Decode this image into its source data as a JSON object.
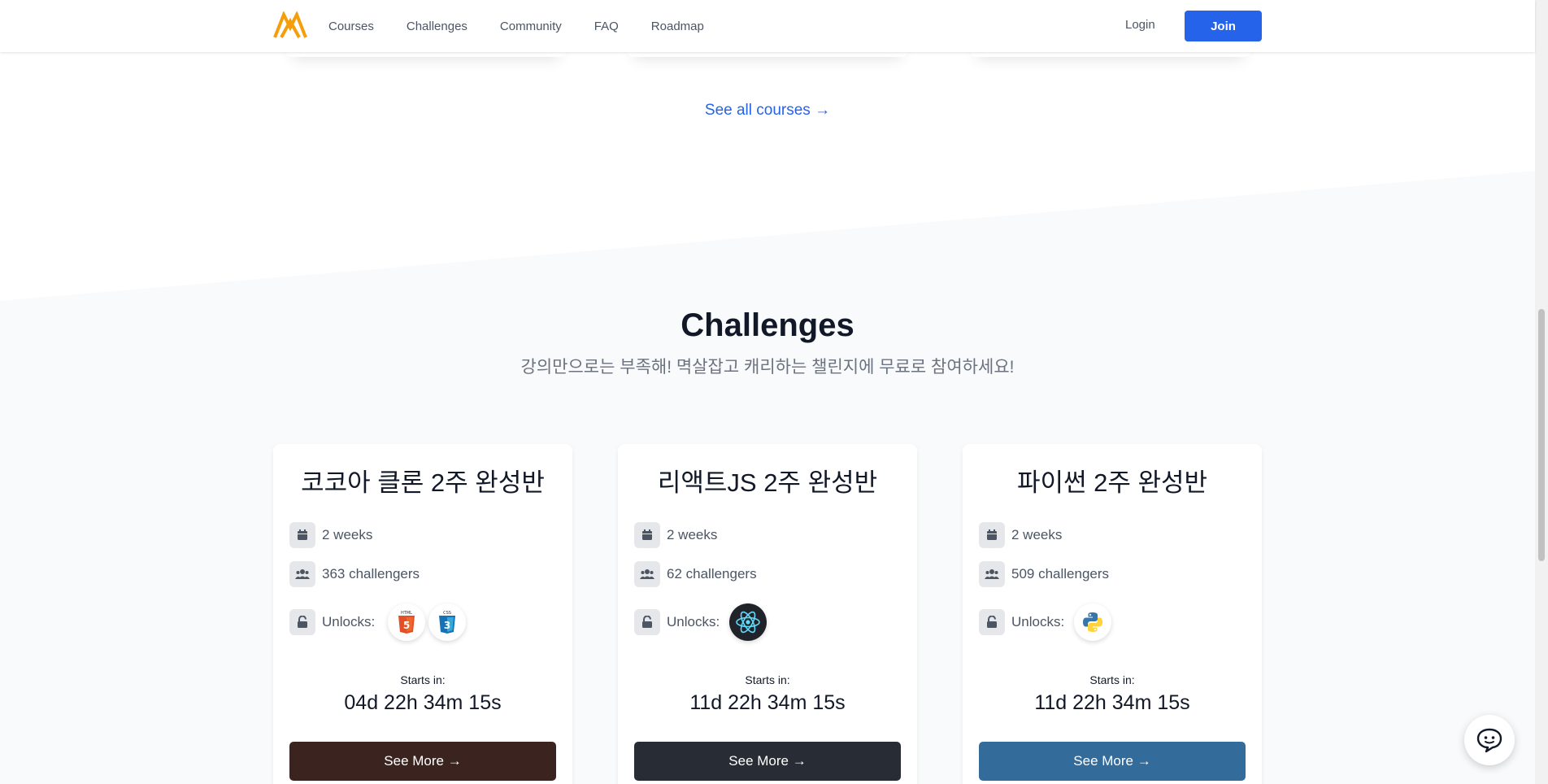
{
  "header": {
    "nav": [
      "Courses",
      "Challenges",
      "Community",
      "FAQ",
      "Roadmap"
    ],
    "login": "Login",
    "join": "Join"
  },
  "see_all_courses": "See all courses →",
  "challenges": {
    "title": "Challenges",
    "subtitle": "강의만으로는 부족해! 멱살잡고 캐리하는 챌린지에 무료로 참여하세요!",
    "unlocks_label": "Unlocks:",
    "starts_label": "Starts in:",
    "cards": [
      {
        "title": "코코아 클론 2주 완성반",
        "duration": "2 weeks",
        "challengers": "363 challengers",
        "unlocks": [
          "html5-icon",
          "css3-icon"
        ],
        "countdown": "04d 22h 34m 15s",
        "cta": "See More →",
        "cta_color": "#3b2420"
      },
      {
        "title": "리액트JS 2주 완성반",
        "duration": "2 weeks",
        "challengers": "62 challengers",
        "unlocks": [
          "react-icon"
        ],
        "countdown": "11d 22h 34m 15s",
        "cta": "See More →",
        "cta_color": "#282c34"
      },
      {
        "title": "파이썬 2주 완성반",
        "duration": "2 weeks",
        "challengers": "509 challengers",
        "unlocks": [
          "python-icon"
        ],
        "countdown": "11d 22h 34m 15s",
        "cta": "See More →",
        "cta_color": "#336b9b"
      }
    ]
  },
  "colors": {
    "accent": "#2563eb",
    "section_bg": "#f9fafb",
    "logo": "#f59e0b"
  }
}
